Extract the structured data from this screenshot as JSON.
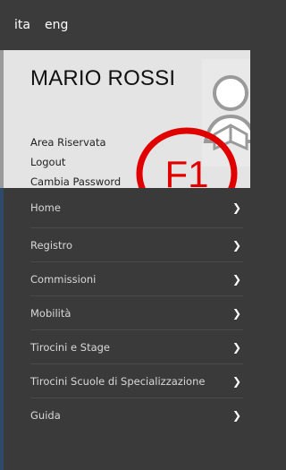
{
  "languages": [
    {
      "label": "ita"
    },
    {
      "label": "eng"
    }
  ],
  "user": {
    "name": "MARIO ROSSI",
    "links": [
      {
        "label": "Area Riservata"
      },
      {
        "label": "Logout"
      },
      {
        "label": "Cambia Password"
      }
    ]
  },
  "annotation": {
    "label": "F1",
    "color": "#e00000"
  },
  "menu": {
    "items": [
      {
        "label": "Home",
        "icon": "chevron-right-icon"
      },
      {
        "label": "Registro",
        "icon": "chevron-right-icon"
      },
      {
        "label": "Commissioni",
        "icon": "chevron-right-icon"
      },
      {
        "label": "Mobilità",
        "icon": "chevron-right-icon"
      },
      {
        "label": "Tirocini e Stage",
        "icon": "chevron-right-icon"
      },
      {
        "label": "Tirocini Scuole di Specializzazione",
        "icon": "chevron-right-icon"
      },
      {
        "label": "Guida",
        "icon": "chevron-right-icon"
      }
    ]
  }
}
